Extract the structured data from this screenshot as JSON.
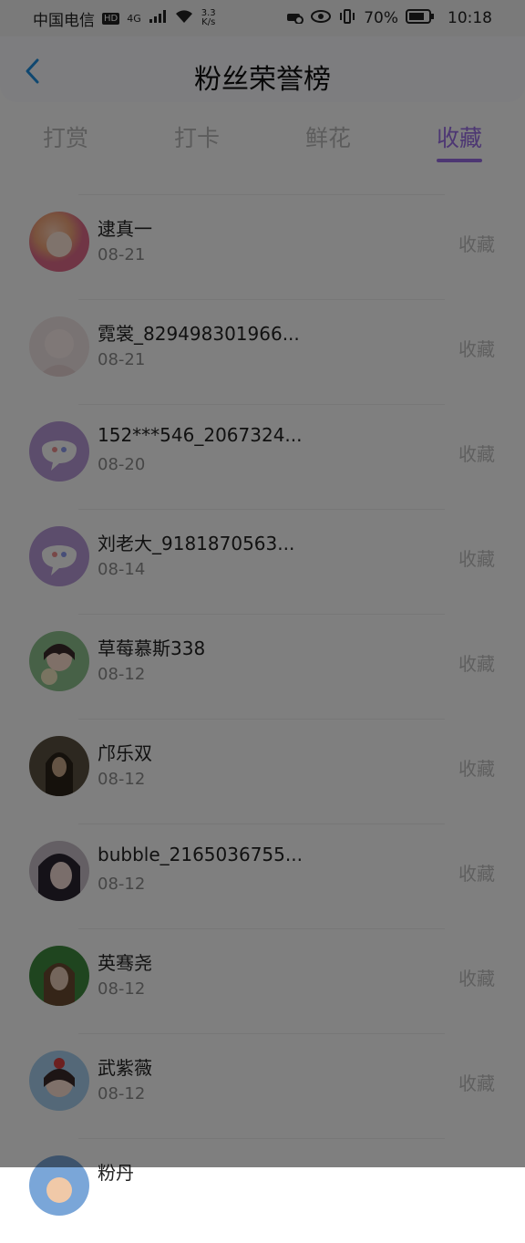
{
  "status_bar": {
    "carrier": "中国电信",
    "hd": "HD",
    "network": "4G",
    "speed_value": "3.3",
    "speed_unit": "K/s",
    "battery": "70%",
    "time": "10:18"
  },
  "header": {
    "title": "粉丝荣誉榜"
  },
  "tabs": [
    {
      "label": "打赏"
    },
    {
      "label": "打卡"
    },
    {
      "label": "鲜花"
    },
    {
      "label": "收藏"
    }
  ],
  "list": [
    {
      "name": "逮真一",
      "date": "08-21",
      "action": "收藏",
      "avatar": "avatar-pink-girl"
    },
    {
      "name": "霓裳_829498301966...",
      "date": "08-21",
      "action": "收藏",
      "avatar": "avatar-anime-girl"
    },
    {
      "name": "152***546_2067324...",
      "date": "08-20",
      "action": "收藏",
      "avatar": "avatar-default-chat"
    },
    {
      "name": "刘老大_9181870563...",
      "date": "08-14",
      "action": "收藏",
      "avatar": "avatar-default-chat"
    },
    {
      "name": "草莓慕斯338",
      "date": "08-12",
      "action": "收藏",
      "avatar": "avatar-anime-rabbit"
    },
    {
      "name": "邝乐双",
      "date": "08-12",
      "action": "收藏",
      "avatar": "avatar-dark-hair"
    },
    {
      "name": "bubble_2165036755...",
      "date": "08-12",
      "action": "收藏",
      "avatar": "avatar-selfie-girl"
    },
    {
      "name": "英骞尧",
      "date": "08-12",
      "action": "收藏",
      "avatar": "avatar-green-girl"
    },
    {
      "name": "武紫薇",
      "date": "08-12",
      "action": "收藏",
      "avatar": "avatar-cartoon-girl"
    },
    {
      "name": "粉丹",
      "date": "",
      "action": "",
      "avatar": "avatar-partial"
    }
  ],
  "colors": {
    "accent": "#9b6ee6",
    "overlay": "rgba(0,0,0,0.5)"
  }
}
